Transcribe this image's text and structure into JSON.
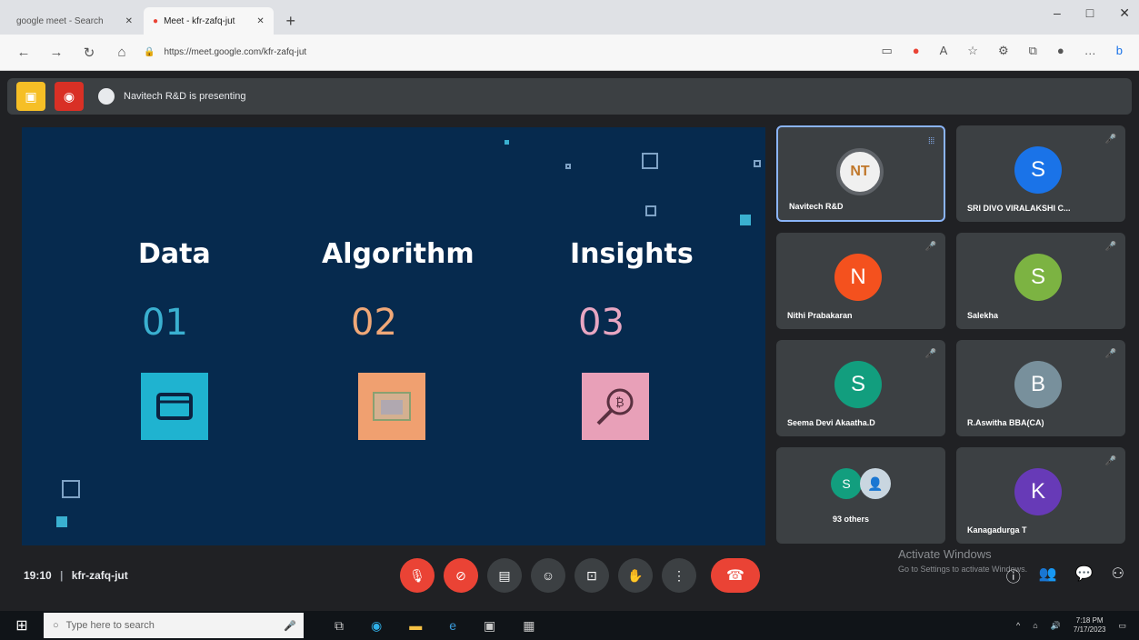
{
  "browser": {
    "tabs": [
      {
        "title": "google meet - Search"
      },
      {
        "title": "Meet - kfr-zafq-jut"
      }
    ],
    "url": "https://meet.google.com/kfr-zafq-jut"
  },
  "meet": {
    "presenting_text": "Navitech R&D is presenting",
    "meeting_time": "19:10",
    "meeting_code": "kfr-zafq-jut"
  },
  "slide": {
    "columns": [
      {
        "heading": "Data",
        "number": "01",
        "number_color": "#3ab0d0",
        "icon_bg": "#1fb3d0",
        "icon": "window-icon"
      },
      {
        "heading": "Algorithm",
        "number": "02",
        "number_color": "#f0a878",
        "icon_bg": "#f0a070",
        "icon": "window-icon"
      },
      {
        "heading": "Insights",
        "number": "03",
        "number_color": "#e8a6c2",
        "icon_bg": "#e8a0b8",
        "icon": "magnifier-bitcoin-icon"
      }
    ]
  },
  "participants": [
    {
      "initial": "NT",
      "name": "Navitech R&D",
      "color": "#ffffff",
      "speaking": true
    },
    {
      "initial": "S",
      "name": "SRI DIVO VIRALAKSHI C...",
      "color": "#1a73e8",
      "speaking": false
    },
    {
      "initial": "N",
      "name": "Nithi Prabakaran",
      "color": "#f4511e",
      "speaking": false
    },
    {
      "initial": "S",
      "name": "Salekha",
      "color": "#7cb342",
      "speaking": false
    },
    {
      "initial": "S",
      "name": "Seema Devi Akaatha.D",
      "color": "#129e7e",
      "speaking": false
    },
    {
      "initial": "B",
      "name": "R.Aswitha BBA(CA)",
      "color": "#78909c",
      "speaking": false
    },
    {
      "initial": "S",
      "name": "93 others",
      "color": "#129e7e",
      "speaking": false
    },
    {
      "initial": "K",
      "name": "Kanagadurga T",
      "color": "#673ab7",
      "speaking": false
    }
  ],
  "watermark": {
    "title": "Activate Windows",
    "subtitle": "Go to Settings to activate Windows."
  },
  "taskbar": {
    "search_placeholder": "Type here to search",
    "time": "7:18 PM",
    "date": "7/17/2023"
  }
}
